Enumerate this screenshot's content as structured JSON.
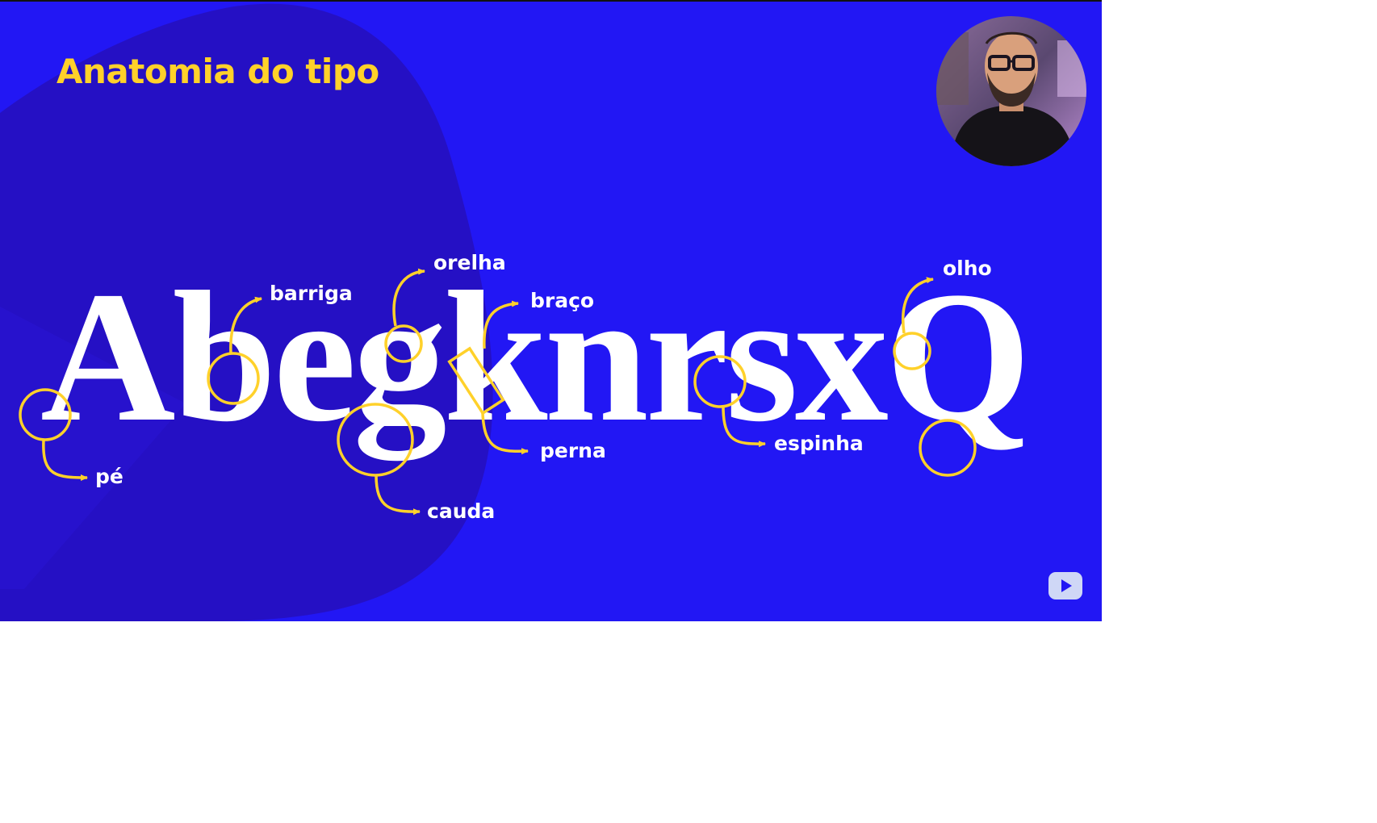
{
  "slide": {
    "title": "Anatomia do tipo",
    "specimen_text": "AbegknrsxQ",
    "labels": {
      "pe": "pé",
      "barriga": "barriga",
      "orelha": "orelha",
      "cauda": "cauda",
      "braco": "braço",
      "perna": "perna",
      "espinha": "espinha",
      "olho": "olho"
    }
  },
  "colors": {
    "background": "#2217f4",
    "blob": "#2510c4",
    "accent": "#ffd12a",
    "text": "#ffffff"
  },
  "icons": {
    "youtube": "youtube-logo-icon"
  }
}
